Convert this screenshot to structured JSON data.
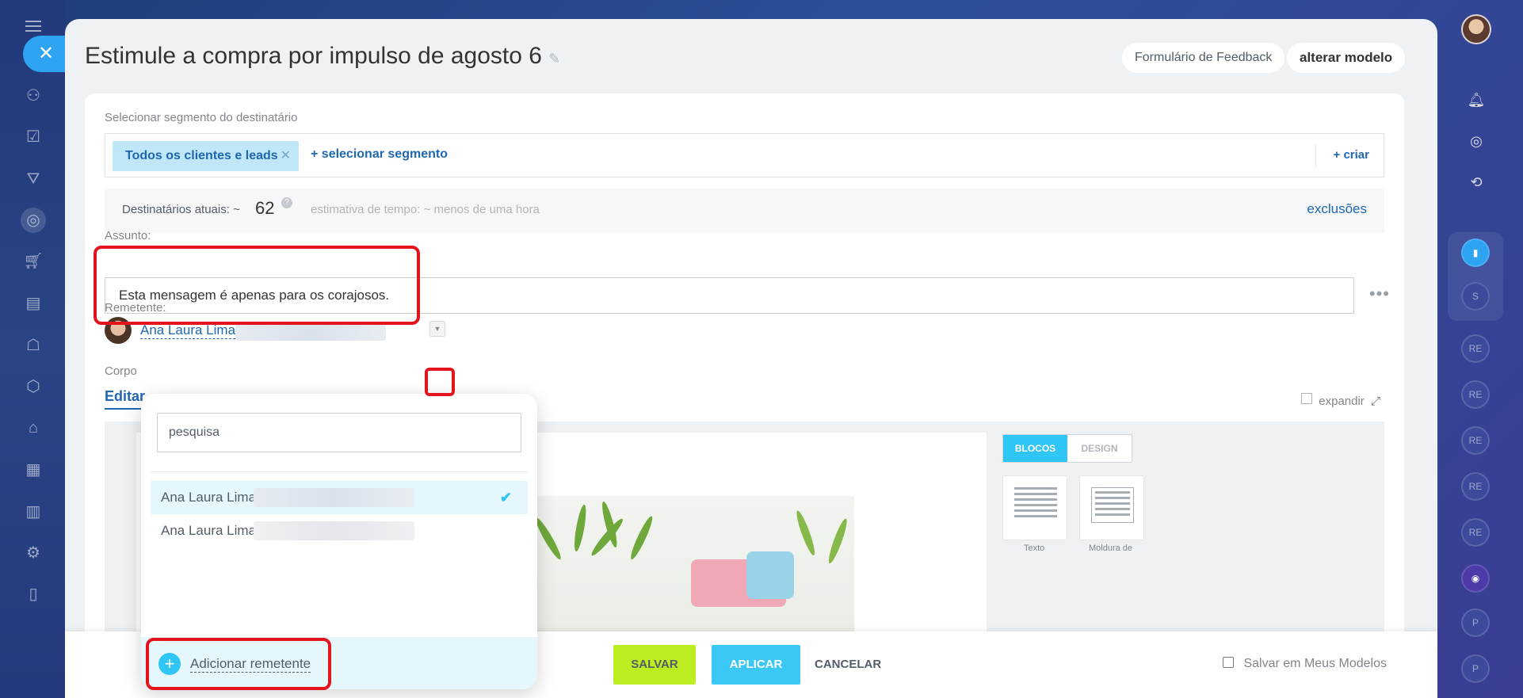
{
  "header": {
    "title": "Estimule a compra por impulso de agosto 6",
    "feedback_button": "Formulário de Feedback",
    "change_template_button": "alterar modelo"
  },
  "segment": {
    "label": "Selecionar segmento do destinatário",
    "chip": "Todos os clientes e leads",
    "select_link": "+ selecionar segmento",
    "create_link": "+ criar"
  },
  "recipients": {
    "label": "Destinatários atuais: ~",
    "count": "62",
    "help": "?",
    "estimate": "estimativa de tempo: ~ menos de uma hora",
    "exclusions_link": "exclusões"
  },
  "subject": {
    "label": "Assunto:",
    "value": "Esta mensagem é apenas para os corajosos.",
    "more": "•••"
  },
  "sender": {
    "label": "Remetente:",
    "name": "Ana Laura Lima",
    "caret": "▼"
  },
  "body": {
    "label": "Corpo",
    "tab_edit": "Editar",
    "expand": "expandir",
    "expand_icon": "⤢",
    "tab_blocks": "BLOCOS",
    "tab_design": "DESIGN",
    "block_text": "Texto",
    "block_frame": "Moldura de"
  },
  "dropdown": {
    "search_placeholder": "pesquisa",
    "options": [
      {
        "label": "Ana Laura Lima",
        "selected": true
      },
      {
        "label": "Ana Laura Lima",
        "selected": false
      }
    ],
    "check": "✔",
    "add_icon": "+",
    "add_sender": "Adicionar remetente"
  },
  "footer": {
    "save": "SALVAR",
    "apply": "APLICAR",
    "cancel": "CANCELAR",
    "save_templates": "Salvar em Meus Modelos"
  },
  "rails": {
    "close": "✕",
    "right_circles": [
      "S",
      "RE",
      "RE",
      "RE",
      "RE",
      "RE",
      "P",
      "P"
    ]
  },
  "colors": {
    "accent": "#2fc6f6",
    "link": "#2067b0",
    "save_green": "#bbed21",
    "highlight_red": "#e3141b"
  }
}
